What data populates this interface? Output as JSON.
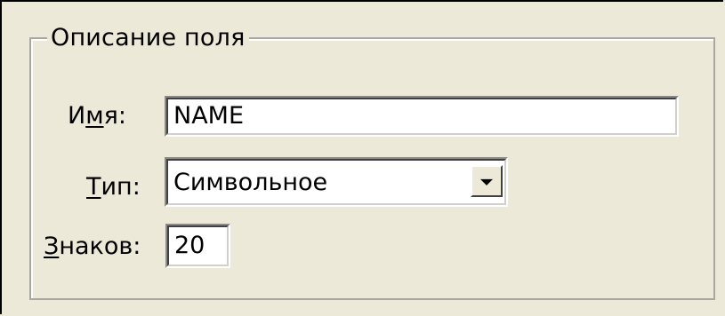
{
  "groupbox": {
    "title": "Описание поля"
  },
  "fields": {
    "name": {
      "label_before": "И",
      "label_accel": "м",
      "label_after": "я:",
      "value": "NAME"
    },
    "type": {
      "label_before": "",
      "label_accel": "Т",
      "label_after": "ип:",
      "value": "Символьное"
    },
    "chars": {
      "label_before": "",
      "label_accel": "З",
      "label_after": "наков:",
      "value": "20"
    }
  },
  "icons": {
    "dropdown": "chevron-down-icon"
  }
}
